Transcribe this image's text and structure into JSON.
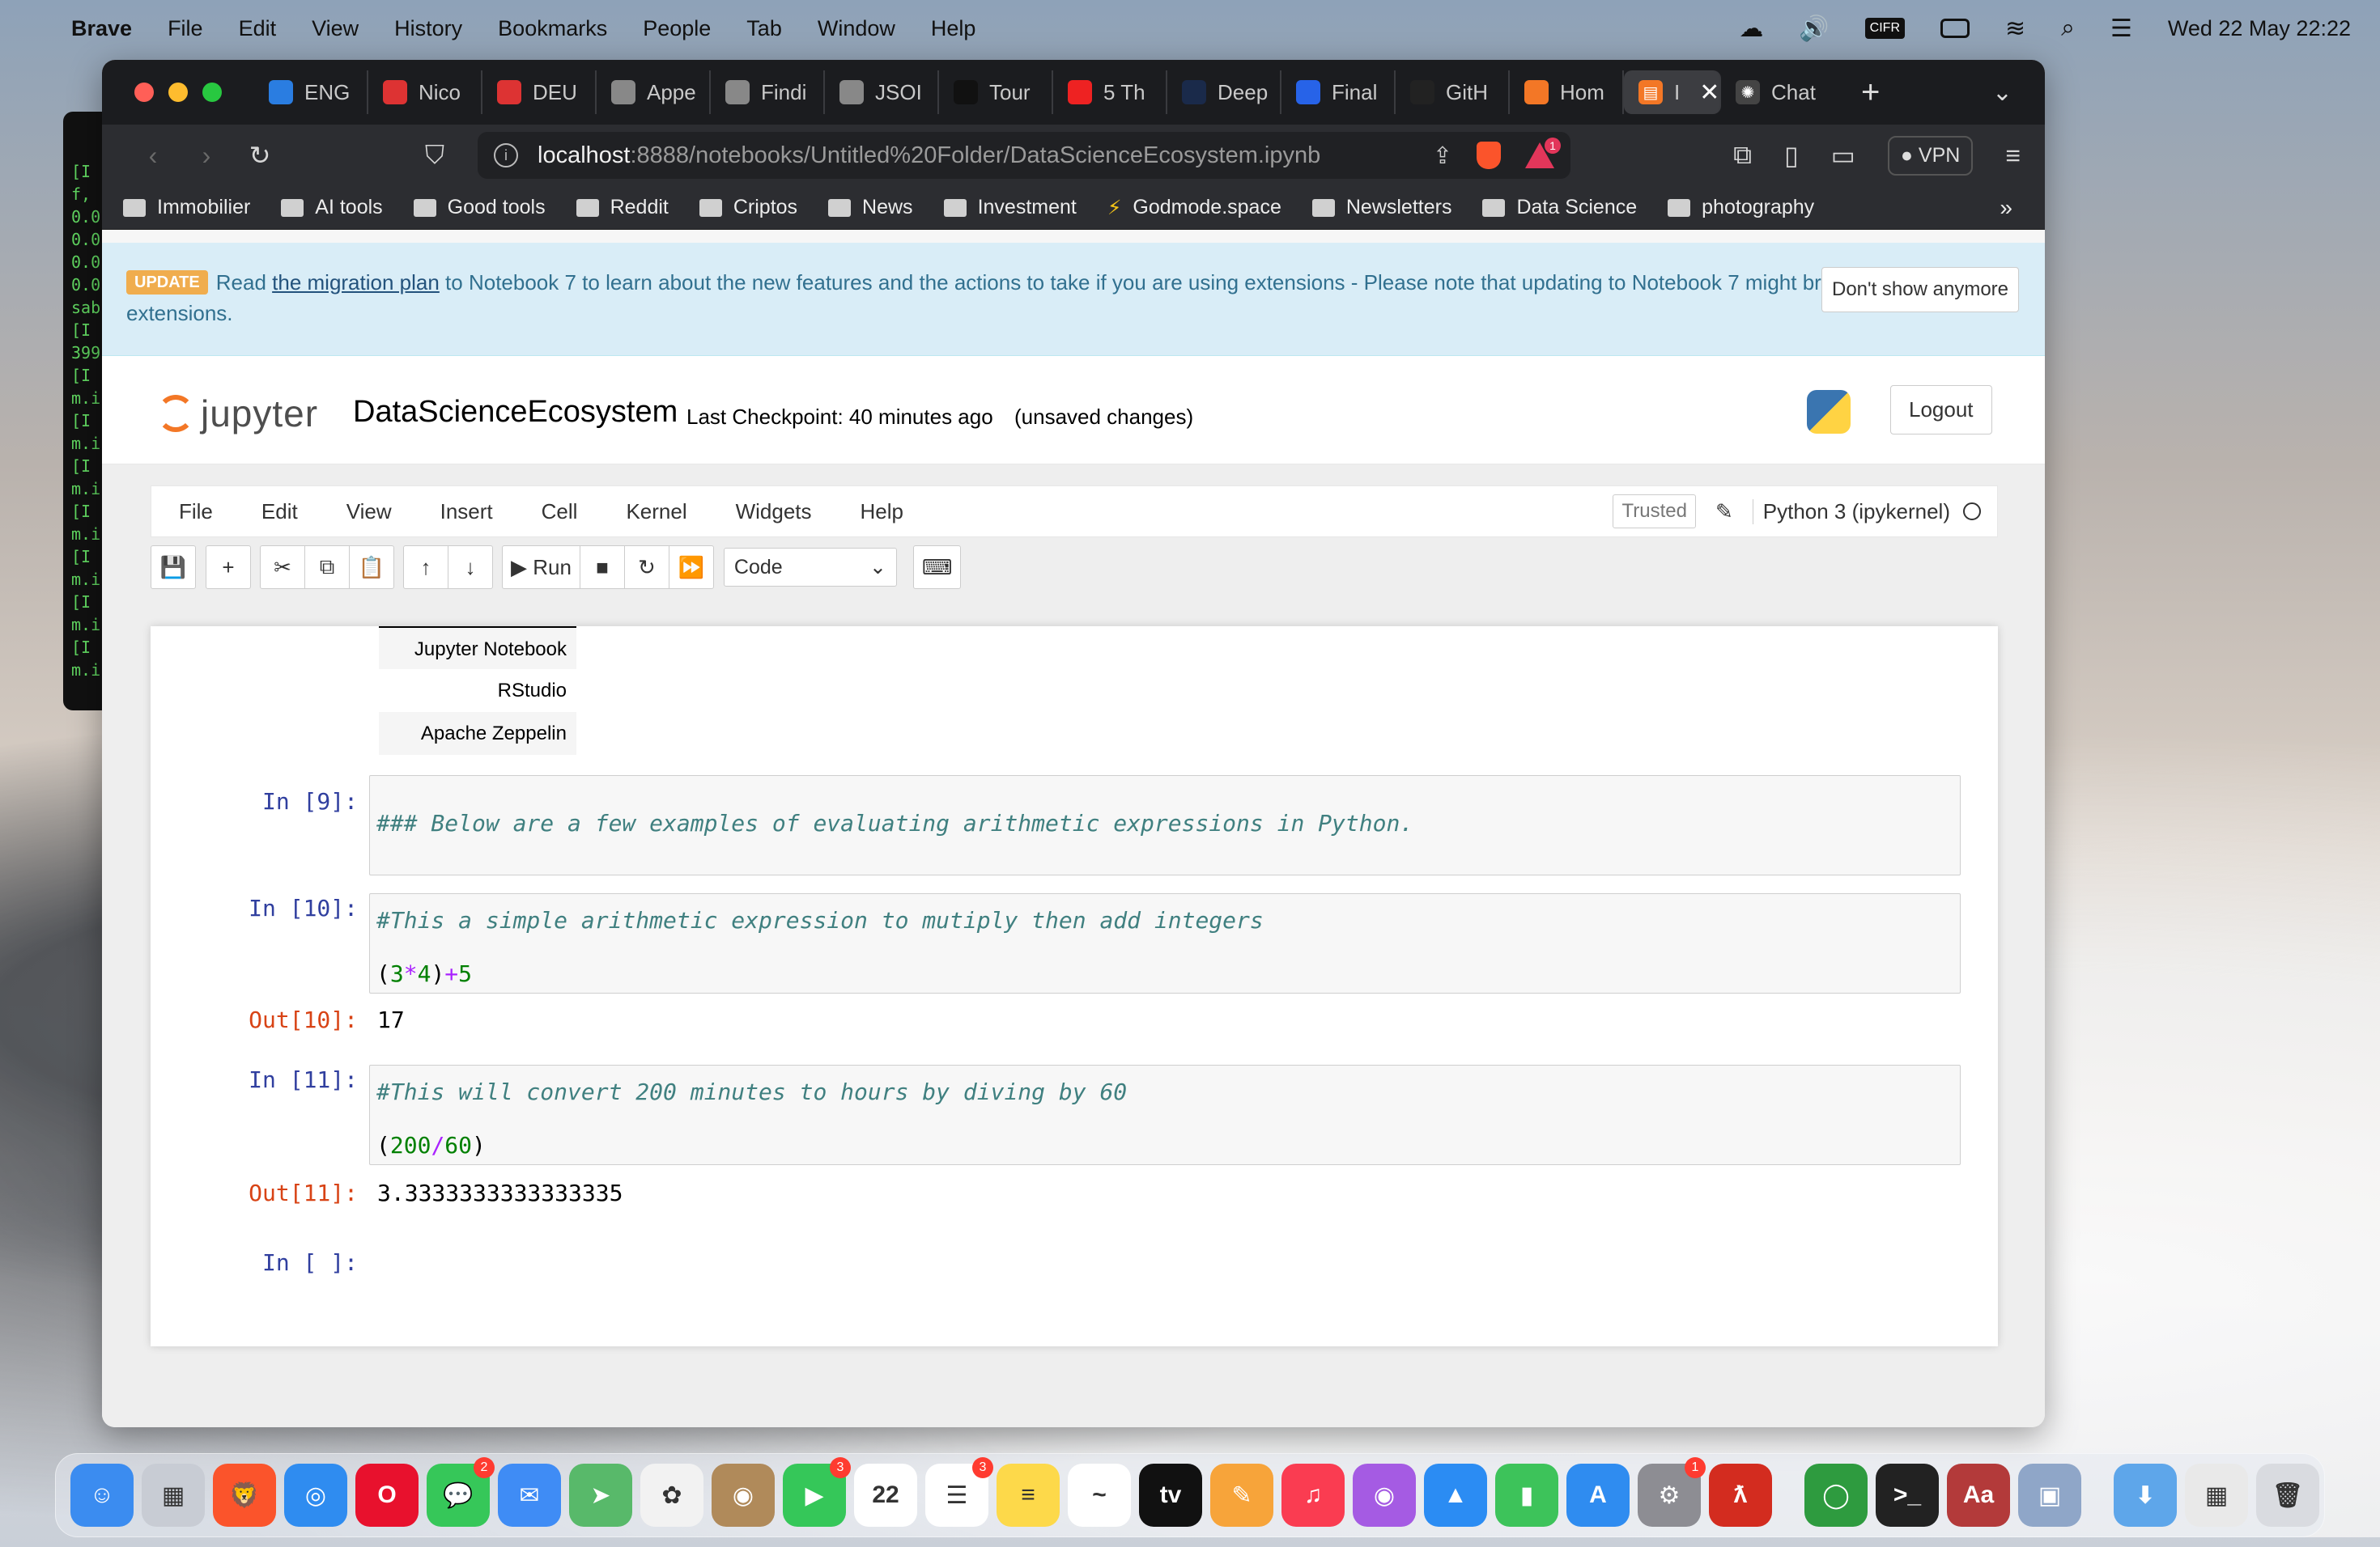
{
  "menubar": {
    "app": "Brave",
    "items": [
      "File",
      "Edit",
      "View",
      "History",
      "Bookmarks",
      "People",
      "Tab",
      "Window",
      "Help"
    ],
    "datetime": "Wed 22 May  22:22"
  },
  "terminal_lines": [
    "[I",
    "f,",
    "0.0",
    "0.0",
    "0.0",
    "0.0",
    "sab",
    "[I",
    "399",
    "[I",
    "m.i",
    "[I",
    "m.i",
    "[I",
    "m.i",
    "[I",
    "m.i",
    "[I",
    "m.i",
    "[I",
    "m.i",
    "[I",
    "m.i"
  ],
  "tabs": [
    {
      "label": "ENG",
      "icon": "e-icon",
      "color": "#2a7de1"
    },
    {
      "label": "Nico",
      "icon": "card-icon",
      "color": "#d33"
    },
    {
      "label": "DEU",
      "icon": "card-icon",
      "color": "#d33"
    },
    {
      "label": "Appe",
      "icon": "globe-icon",
      "color": "#888"
    },
    {
      "label": "Findi",
      "icon": "globe-icon",
      "color": "#888"
    },
    {
      "label": "JSOI",
      "icon": "globe-icon",
      "color": "#888"
    },
    {
      "label": "Tour",
      "icon": "c-icon",
      "color": "#111"
    },
    {
      "label": "5 Th",
      "icon": "youtube-icon",
      "color": "#e22"
    },
    {
      "label": "Deep",
      "icon": "play-icon",
      "color": "#1a2a4a"
    },
    {
      "label": "Final",
      "icon": "c-icon",
      "color": "#2763e8"
    },
    {
      "label": "GitH",
      "icon": "github-icon",
      "color": "#222"
    },
    {
      "label": "Hom",
      "icon": "jupyter-icon",
      "color": "#f37726"
    }
  ],
  "active_tab": {
    "label": "I",
    "icon": "notebook-icon"
  },
  "last_tab": {
    "label": "Chat",
    "icon": "openai-icon"
  },
  "url": {
    "host": "localhost",
    "path": ":8888/notebooks/Untitled%20Folder/DataScienceEcosystem.ipynb"
  },
  "brave_badge": "1",
  "vpn_label": "VPN",
  "bookmarks": [
    "Immobilier",
    "AI tools",
    "Good tools",
    "Reddit",
    "Criptos",
    "News",
    "Investment",
    "Godmode.space",
    "Newsletters",
    "Data Science",
    "photography"
  ],
  "notice": {
    "badge": "UPDATE",
    "pre": "Read ",
    "link": "the migration plan",
    "post": " to Notebook 7 to learn about the new features and the actions to take if you are using extensions - Please note that updating to Notebook 7 might break some of your extensions.",
    "dismiss": "Don't show anymore"
  },
  "header": {
    "logo_text": "jupyter",
    "notebook_name": "DataScienceEcosystem",
    "checkpoint": "Last Checkpoint: 40 minutes ago",
    "unsaved": "(unsaved changes)",
    "logout": "Logout"
  },
  "nb_menu": [
    "File",
    "Edit",
    "View",
    "Insert",
    "Cell",
    "Kernel",
    "Widgets",
    "Help"
  ],
  "trusted": "Trusted",
  "kernel": "Python 3 (ipykernel)",
  "toolbar": {
    "run": "Run",
    "cell_type": "Code"
  },
  "table_rows": [
    "Jupyter Notebook",
    "RStudio",
    "Apache Zeppelin"
  ],
  "cells": [
    {
      "prompt": "In [9]:",
      "lines": [
        [
          "cmt",
          "### Below are a few examples of evaluating arithmetic expressions in Python."
        ]
      ]
    },
    {
      "prompt": "In [10]:",
      "lines": [
        [
          "cmt",
          "#This a simple arithmetic expression to mutiply then add integers"
        ],
        [
          "code",
          "(3*4)+5"
        ]
      ],
      "out_prompt": "Out[10]:",
      "out": "17"
    },
    {
      "prompt": "In [11]:",
      "lines": [
        [
          "cmt",
          "#This will convert 200 minutes to hours by diving by 60"
        ],
        [
          "code",
          "(200/60)"
        ]
      ],
      "out_prompt": "Out[11]:",
      "out": "3.3333333333333335"
    },
    {
      "prompt": "In [ ]:"
    }
  ],
  "dock": [
    {
      "name": "finder",
      "color": "#3b8cf0",
      "glyph": "☺"
    },
    {
      "name": "launchpad",
      "color": "#c8ccd4",
      "glyph": "▦"
    },
    {
      "name": "brave",
      "color": "#fb542b",
      "glyph": "🦁"
    },
    {
      "name": "safari",
      "color": "#2f8cf0",
      "glyph": "◎"
    },
    {
      "name": "opera",
      "color": "#e8112d",
      "glyph": "O"
    },
    {
      "name": "messages",
      "color": "#36c759",
      "glyph": "💬",
      "badge": "2"
    },
    {
      "name": "mail",
      "color": "#3f8cf5",
      "glyph": "✉"
    },
    {
      "name": "maps",
      "color": "#58b96a",
      "glyph": "➤"
    },
    {
      "name": "photos",
      "color": "#f2f2f2",
      "glyph": "✿"
    },
    {
      "name": "contacts",
      "color": "#b08a5a",
      "glyph": "◉"
    },
    {
      "name": "facetime",
      "color": "#35c759",
      "glyph": "▶",
      "badge": "3"
    },
    {
      "name": "calendar",
      "color": "#ffffff",
      "glyph": "22"
    },
    {
      "name": "reminders",
      "color": "#ffffff",
      "glyph": "☰",
      "badge": "3"
    },
    {
      "name": "notes",
      "color": "#fdd94a",
      "glyph": "≡"
    },
    {
      "name": "freeform",
      "color": "#ffffff",
      "glyph": "~"
    },
    {
      "name": "tv",
      "color": "#111111",
      "glyph": "tv"
    },
    {
      "name": "pages",
      "color": "#f7a43a",
      "glyph": "✎"
    },
    {
      "name": "music",
      "color": "#fa3c51",
      "glyph": "♫"
    },
    {
      "name": "podcasts",
      "color": "#a55be3",
      "glyph": "◉"
    },
    {
      "name": "keynote",
      "color": "#2b8cf3",
      "glyph": "▲"
    },
    {
      "name": "numbers",
      "color": "#3dc35a",
      "glyph": "▮"
    },
    {
      "name": "app-store",
      "color": "#2f8cf0",
      "glyph": "A"
    },
    {
      "name": "system-settings",
      "color": "#8d8d93",
      "glyph": "⚙",
      "badge": "1"
    },
    {
      "name": "acrobat",
      "color": "#d32c1f",
      "glyph": "ƛ"
    },
    {
      "name": "activity",
      "color": "#2e9b3f",
      "glyph": "◯"
    },
    {
      "name": "terminal",
      "color": "#222222",
      "glyph": ">_"
    },
    {
      "name": "dictionary",
      "color": "#b33a3a",
      "glyph": "Aa"
    },
    {
      "name": "preview",
      "color": "#8fa6c8",
      "glyph": "▣"
    },
    {
      "name": "downloads",
      "color": "#5ea6ea",
      "glyph": "⬇"
    },
    {
      "name": "screenshot",
      "color": "#e9e9e9",
      "glyph": "▦"
    },
    {
      "name": "trash",
      "color": "#d9dbe0",
      "glyph": "🗑"
    }
  ]
}
